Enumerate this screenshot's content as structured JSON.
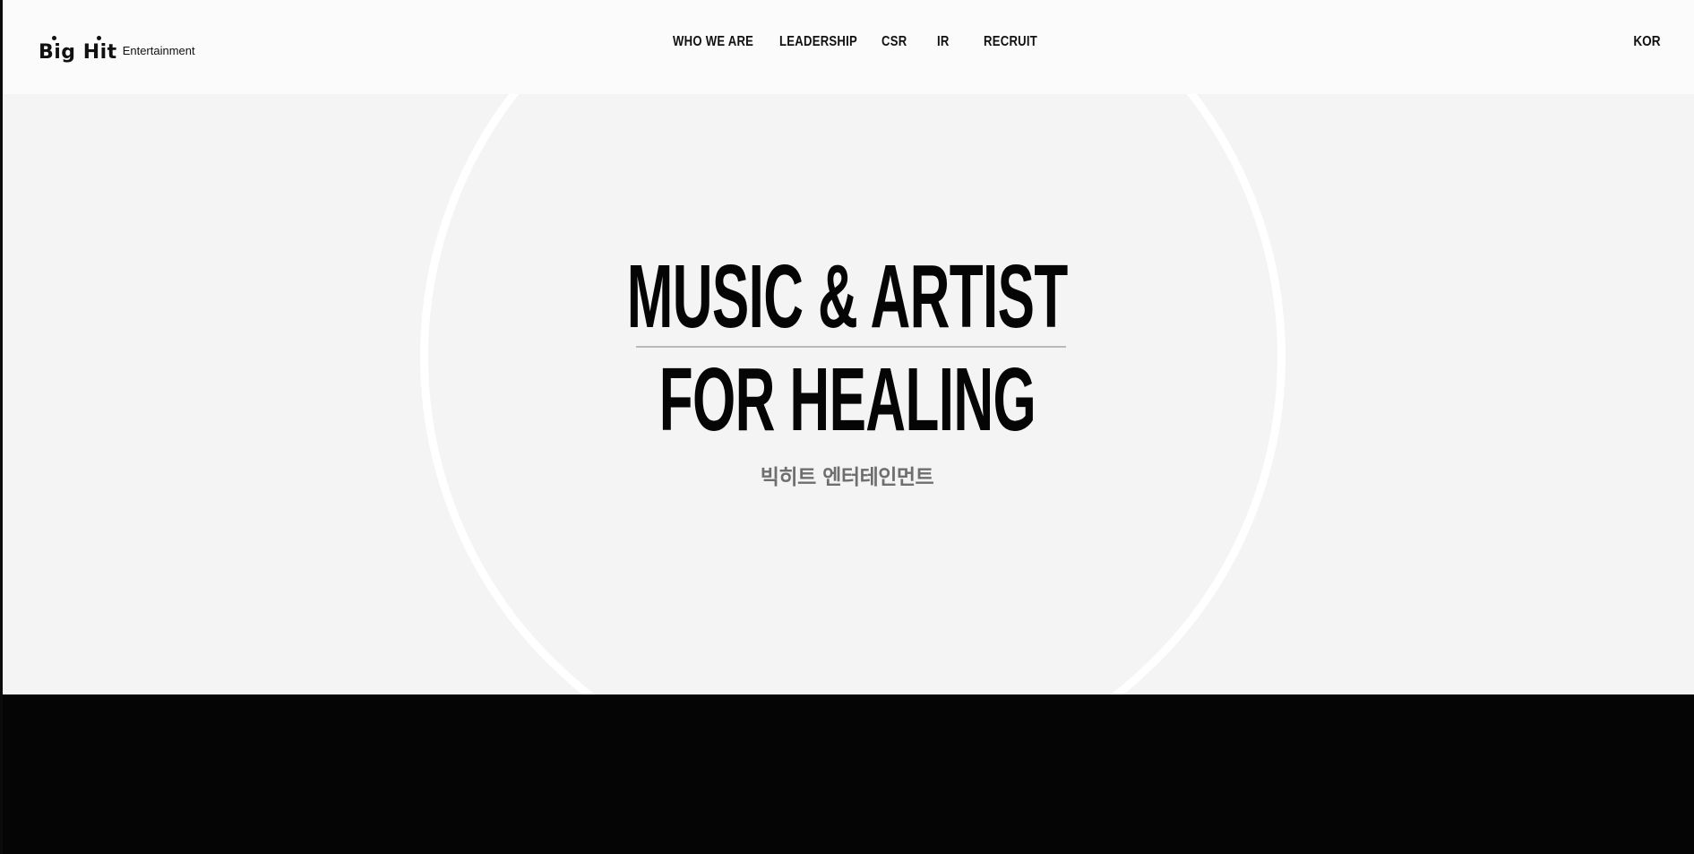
{
  "header": {
    "logo": {
      "mark": "Big Hit",
      "sub": "Entertainment"
    },
    "nav": [
      {
        "label": "WHO WE ARE"
      },
      {
        "label": "LEADERSHIP"
      },
      {
        "label": "CSR"
      },
      {
        "label": "IR"
      },
      {
        "label": "RECRUIT"
      }
    ],
    "language": "KOR"
  },
  "hero": {
    "headline_line1": "MUSIC & ARTIST",
    "headline_line2": "FOR HEALING",
    "subtitle": "빅히트 엔터테인먼트"
  },
  "colors": {
    "background": "#f4f4f4",
    "header_background": "#fbfbfb",
    "ring": "#ffffff",
    "text": "#050505",
    "subtitle": "#6e6e6e",
    "divider": "#b9b9b9",
    "footer_band": "#050505"
  }
}
